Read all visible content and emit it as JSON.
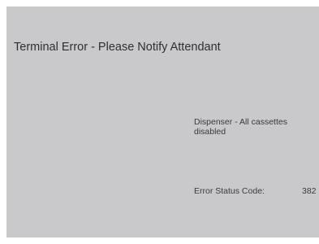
{
  "screen": {
    "title": "Terminal Error - Please Notify Attendant",
    "message": "Dispenser - All cassettes disabled",
    "status_label": "Error Status Code:",
    "status_code": "382"
  }
}
